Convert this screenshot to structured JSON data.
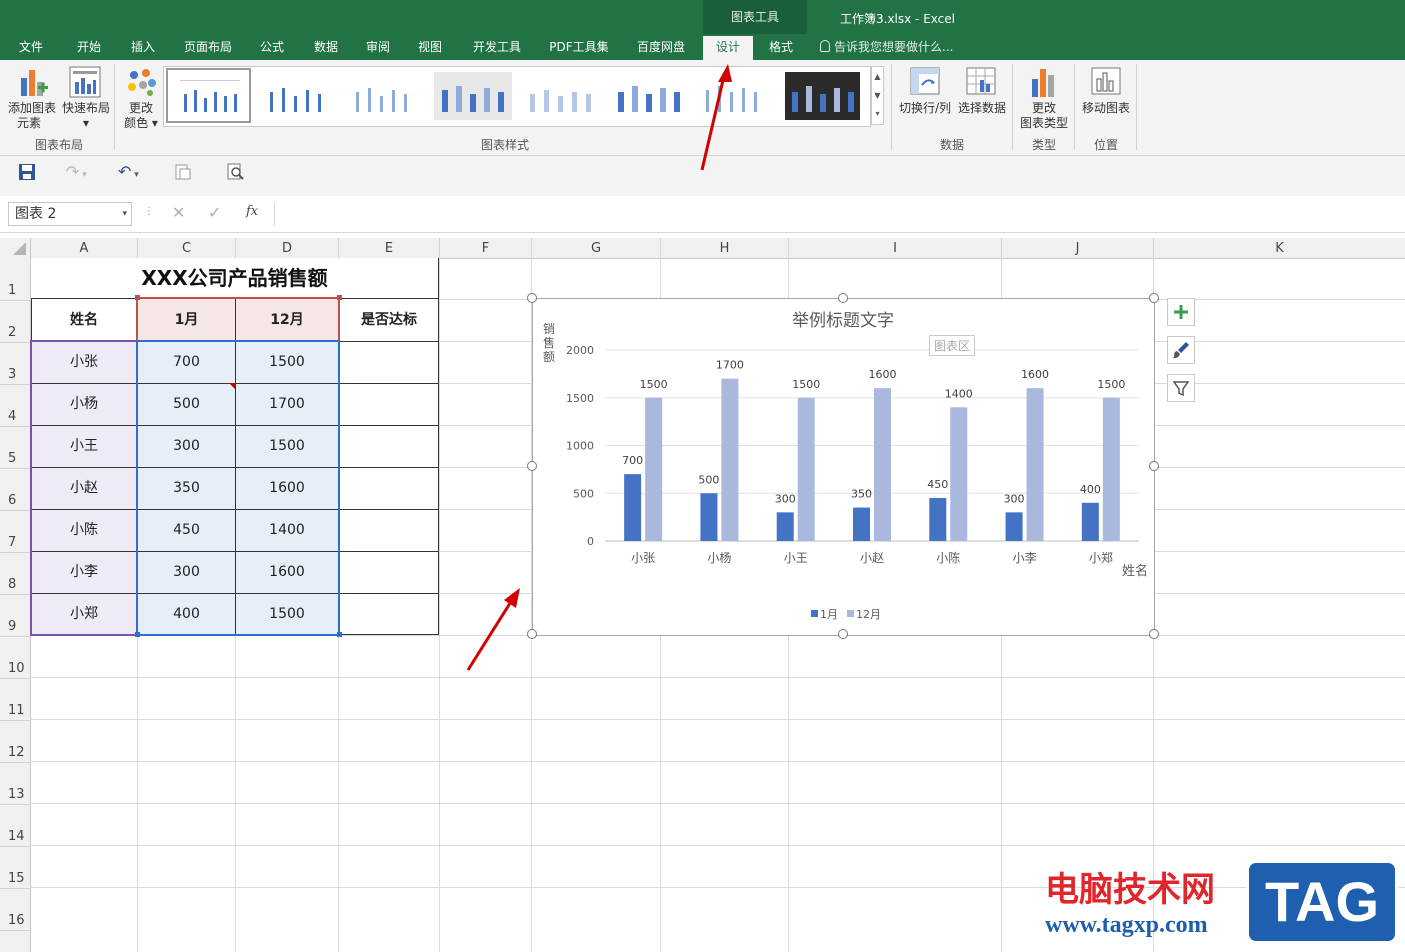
{
  "app": {
    "context_group": "图表工具",
    "window_title": "工作簿3.xlsx - Excel",
    "tabs": [
      "文件",
      "开始",
      "插入",
      "页面布局",
      "公式",
      "数据",
      "审阅",
      "视图",
      "开发工具",
      "PDF工具集",
      "百度网盘",
      "设计",
      "格式"
    ],
    "active_tab": "设计",
    "tell_me": "告诉我您想要做什么..."
  },
  "ribbon": {
    "add_element": [
      "添加图表",
      "元素"
    ],
    "quick_layout": "快速布局",
    "change_colors": [
      "更改",
      "颜色"
    ],
    "switch_row_col": "切换行/列",
    "select_data": "选择数据",
    "change_type": [
      "更改",
      "图表类型"
    ],
    "move_chart": "移动图表",
    "groups": {
      "layout": "图表布局",
      "styles": "图表样式",
      "data": "数据",
      "type": "类型",
      "location": "位置"
    }
  },
  "formula_bar": {
    "name_box": "图表 2",
    "fx": "fx",
    "value": ""
  },
  "grid": {
    "columns": [
      "A",
      "C",
      "D",
      "E",
      "F",
      "G",
      "H",
      "I",
      "J",
      "K"
    ],
    "rows": [
      "1",
      "2",
      "3",
      "4",
      "5",
      "6",
      "7",
      "8",
      "9",
      "10",
      "11",
      "12",
      "13",
      "14",
      "15",
      "16"
    ]
  },
  "table": {
    "title": "XXX公司产品销售额",
    "headers": [
      "姓名",
      "1月",
      "12月",
      "是否达标"
    ],
    "rows": [
      [
        "小张",
        "700",
        "1500",
        ""
      ],
      [
        "小杨",
        "500",
        "1700",
        ""
      ],
      [
        "小王",
        "300",
        "1500",
        ""
      ],
      [
        "小赵",
        "350",
        "1600",
        ""
      ],
      [
        "小陈",
        "450",
        "1400",
        ""
      ],
      [
        "小李",
        "300",
        "1600",
        ""
      ],
      [
        "小郑",
        "400",
        "1500",
        ""
      ]
    ]
  },
  "chart_tooltip": "图表区",
  "chart_data": {
    "type": "bar",
    "title": "举例标题文字",
    "ylabel": "销售额",
    "xlabel": "姓名",
    "categories": [
      "小张",
      "小杨",
      "小王",
      "小赵",
      "小陈",
      "小李",
      "小郑"
    ],
    "series": [
      {
        "name": "1月",
        "values": [
          700,
          500,
          300,
          350,
          450,
          300,
          400
        ],
        "color": "#4472c4"
      },
      {
        "name": "12月",
        "values": [
          1500,
          1700,
          1500,
          1600,
          1400,
          1600,
          1500
        ],
        "color": "#a9b8dc"
      }
    ],
    "yticks": [
      "0",
      "500",
      "1000",
      "1500",
      "2000"
    ],
    "ylim": [
      0,
      2000
    ],
    "grid": true,
    "legend": "bottom"
  },
  "watermark": {
    "text": "电脑技术网",
    "url": "www.tagxp.com",
    "logo": "TAG"
  }
}
